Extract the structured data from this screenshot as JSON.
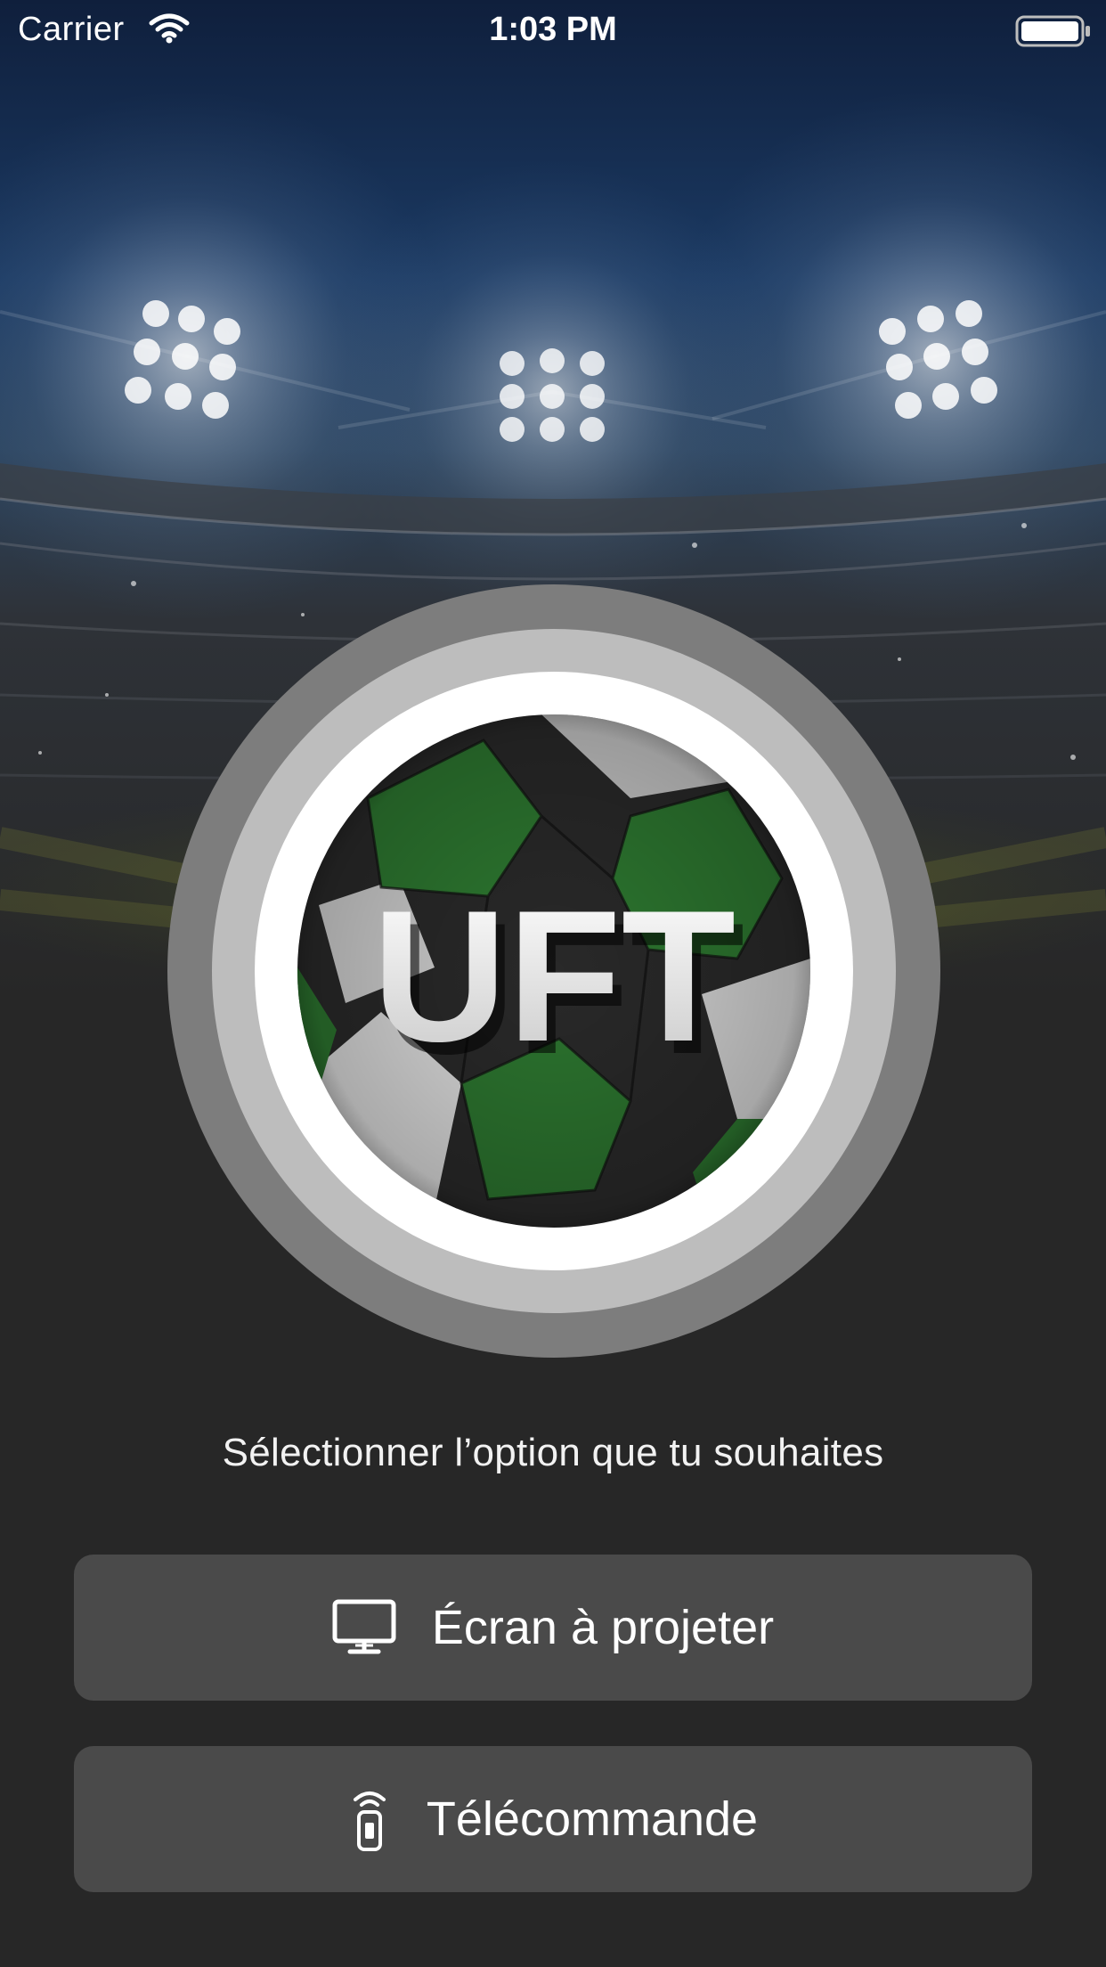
{
  "status_bar": {
    "carrier": "Carrier",
    "time": "1:03 PM",
    "wifi_icon": "wifi-icon",
    "battery_icon": "battery-full-icon"
  },
  "logo": {
    "text": "UFT",
    "icon": "soccer-ball-icon"
  },
  "prompt": "Sélectionner l’option que tu souhaites",
  "options": [
    {
      "label": "Écran à projeter",
      "icon": "monitor-icon"
    },
    {
      "label": "Télécommande",
      "icon": "remote-control-icon"
    }
  ],
  "colors": {
    "background": "#272727",
    "button": "#4a4a4a",
    "text": "#ffffff",
    "ball_green": "#2f7d32",
    "sky": "#13284a"
  }
}
